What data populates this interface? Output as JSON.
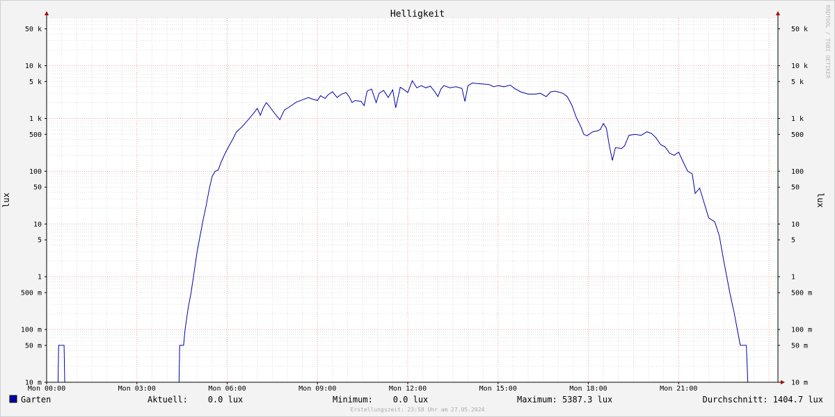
{
  "chart_data": {
    "type": "line",
    "title": "Helligkeit",
    "ylabel": "lux",
    "ylabel_right": "lux",
    "yscale": "log",
    "ylim": [
      0.01,
      80000
    ],
    "xlim_hours": [
      0,
      24.3
    ],
    "grid": true,
    "x_ticks": [
      {
        "h": 0,
        "label": "Mon 00:00"
      },
      {
        "h": 3,
        "label": "Mon 03:00"
      },
      {
        "h": 6,
        "label": "Mon 06:00"
      },
      {
        "h": 9,
        "label": "Mon 09:00"
      },
      {
        "h": 12,
        "label": "Mon 12:00"
      },
      {
        "h": 15,
        "label": "Mon 15:00"
      },
      {
        "h": 18,
        "label": "Mon 18:00"
      },
      {
        "h": 21,
        "label": "Mon 21:00"
      }
    ],
    "y_ticks": [
      {
        "v": 50000,
        "label": "50 k"
      },
      {
        "v": 10000,
        "label": "10 k"
      },
      {
        "v": 5000,
        "label": "5 k"
      },
      {
        "v": 1000,
        "label": "1 k"
      },
      {
        "v": 500,
        "label": "500"
      },
      {
        "v": 100,
        "label": "100"
      },
      {
        "v": 50,
        "label": "50"
      },
      {
        "v": 10,
        "label": "10"
      },
      {
        "v": 5,
        "label": "5"
      },
      {
        "v": 1,
        "label": "1"
      },
      {
        "v": 0.5,
        "label": "500 m"
      },
      {
        "v": 0.1,
        "label": "100 m"
      },
      {
        "v": 0.05,
        "label": "50 m"
      },
      {
        "v": 0.01,
        "label": "10 m"
      }
    ],
    "series": [
      {
        "name": "Garten",
        "color": "#0000aa",
        "points": [
          [
            0,
            0.01
          ],
          [
            0.38,
            0.01
          ],
          [
            0.4,
            0.05
          ],
          [
            0.58,
            0.05
          ],
          [
            0.6,
            0.01
          ],
          [
            4.4,
            0.01
          ],
          [
            4.42,
            0.05
          ],
          [
            4.55,
            0.05
          ],
          [
            4.6,
            0.1
          ],
          [
            4.7,
            0.25
          ],
          [
            4.8,
            0.5
          ],
          [
            4.9,
            1.2
          ],
          [
            5.0,
            3
          ],
          [
            5.1,
            6
          ],
          [
            5.2,
            12
          ],
          [
            5.3,
            22
          ],
          [
            5.4,
            45
          ],
          [
            5.5,
            80
          ],
          [
            5.6,
            100
          ],
          [
            5.7,
            105
          ],
          [
            5.8,
            150
          ],
          [
            5.9,
            200
          ],
          [
            6.0,
            260
          ],
          [
            6.1,
            330
          ],
          [
            6.2,
            420
          ],
          [
            6.3,
            550
          ],
          [
            6.5,
            700
          ],
          [
            6.7,
            950
          ],
          [
            6.9,
            1300
          ],
          [
            7.0,
            1550
          ],
          [
            7.1,
            1150
          ],
          [
            7.2,
            1600
          ],
          [
            7.3,
            2000
          ],
          [
            7.4,
            1700
          ],
          [
            7.6,
            1200
          ],
          [
            7.75,
            950
          ],
          [
            7.9,
            1450
          ],
          [
            8.1,
            1700
          ],
          [
            8.3,
            2050
          ],
          [
            8.5,
            2250
          ],
          [
            8.7,
            2500
          ],
          [
            8.85,
            2300
          ],
          [
            9.0,
            2200
          ],
          [
            9.1,
            2700
          ],
          [
            9.25,
            2400
          ],
          [
            9.35,
            2800
          ],
          [
            9.5,
            3200
          ],
          [
            9.65,
            2500
          ],
          [
            9.8,
            2900
          ],
          [
            9.95,
            3100
          ],
          [
            10.05,
            2600
          ],
          [
            10.15,
            2000
          ],
          [
            10.25,
            2200
          ],
          [
            10.45,
            2100
          ],
          [
            10.55,
            1750
          ],
          [
            10.65,
            3300
          ],
          [
            10.8,
            3600
          ],
          [
            10.95,
            2000
          ],
          [
            11.05,
            3000
          ],
          [
            11.2,
            3400
          ],
          [
            11.35,
            2500
          ],
          [
            11.5,
            3500
          ],
          [
            11.6,
            1600
          ],
          [
            11.75,
            3900
          ],
          [
            11.85,
            3600
          ],
          [
            12.0,
            3100
          ],
          [
            12.15,
            5200
          ],
          [
            12.3,
            3800
          ],
          [
            12.45,
            4200
          ],
          [
            12.6,
            3800
          ],
          [
            12.75,
            4100
          ],
          [
            12.9,
            3200
          ],
          [
            13.0,
            2600
          ],
          [
            13.1,
            3600
          ],
          [
            13.2,
            4200
          ],
          [
            13.4,
            3800
          ],
          [
            13.6,
            4000
          ],
          [
            13.8,
            3700
          ],
          [
            13.9,
            2100
          ],
          [
            14.0,
            4200
          ],
          [
            14.15,
            4700
          ],
          [
            14.3,
            4600
          ],
          [
            14.5,
            4500
          ],
          [
            14.7,
            4400
          ],
          [
            14.85,
            4000
          ],
          [
            15.0,
            4200
          ],
          [
            15.2,
            4000
          ],
          [
            15.4,
            4300
          ],
          [
            15.55,
            3700
          ],
          [
            15.75,
            3200
          ],
          [
            16.0,
            2900
          ],
          [
            16.25,
            2900
          ],
          [
            16.4,
            3000
          ],
          [
            16.6,
            2600
          ],
          [
            16.75,
            3200
          ],
          [
            16.9,
            3300
          ],
          [
            17.15,
            3000
          ],
          [
            17.3,
            2600
          ],
          [
            17.45,
            1800
          ],
          [
            17.6,
            1050
          ],
          [
            17.75,
            700
          ],
          [
            17.85,
            500
          ],
          [
            17.95,
            470
          ],
          [
            18.15,
            560
          ],
          [
            18.3,
            580
          ],
          [
            18.4,
            620
          ],
          [
            18.5,
            800
          ],
          [
            18.6,
            650
          ],
          [
            18.7,
            300
          ],
          [
            18.8,
            160
          ],
          [
            18.9,
            280
          ],
          [
            19.1,
            270
          ],
          [
            19.2,
            300
          ],
          [
            19.35,
            480
          ],
          [
            19.55,
            500
          ],
          [
            19.75,
            480
          ],
          [
            19.95,
            560
          ],
          [
            20.1,
            520
          ],
          [
            20.25,
            430
          ],
          [
            20.4,
            320
          ],
          [
            20.55,
            290
          ],
          [
            20.7,
            220
          ],
          [
            20.85,
            200
          ],
          [
            21.0,
            230
          ],
          [
            21.15,
            150
          ],
          [
            21.3,
            100
          ],
          [
            21.45,
            90
          ],
          [
            21.55,
            38
          ],
          [
            21.7,
            48
          ],
          [
            21.85,
            25
          ],
          [
            22.0,
            13
          ],
          [
            22.2,
            11
          ],
          [
            22.35,
            6
          ],
          [
            22.5,
            2
          ],
          [
            22.7,
            0.5
          ],
          [
            22.85,
            0.2
          ],
          [
            22.95,
            0.1
          ],
          [
            23.05,
            0.05
          ],
          [
            23.25,
            0.05
          ],
          [
            23.3,
            0.01
          ],
          [
            24.3,
            0.01
          ]
        ]
      }
    ]
  },
  "legend": {
    "label": "Garten",
    "color": "#0000aa",
    "current": "Aktuell:    0.0 lux",
    "minimum": "Minimum:    0.0 lux",
    "maximum": "Maximum: 5387.3 lux",
    "average": "Durchschnitt: 1404.7 lux"
  },
  "footer": "Erstellungszeit: 23:58 Uhr am 27.05.2024",
  "watermark": "RRDTOOL / TOBI OETIKER"
}
